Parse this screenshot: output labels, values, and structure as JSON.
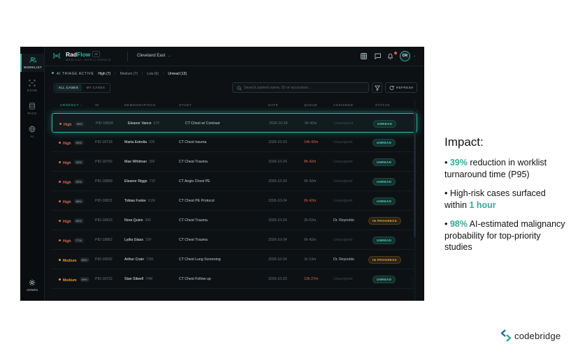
{
  "sidebar": {
    "items": [
      {
        "label": "WORKLIST",
        "icon": "users-icon",
        "active": true
      },
      {
        "label": "EXAM",
        "icon": "scan-icon",
        "active": false
      },
      {
        "label": "PACS",
        "icon": "database-icon",
        "active": false
      },
      {
        "label": "AI",
        "icon": "globe-icon",
        "active": false
      }
    ],
    "admin": {
      "label": "ADMIN",
      "icon": "gear-icon"
    }
  },
  "header": {
    "brand_rad": "Rad",
    "brand_flow": "Flow",
    "brand_badge": "AI",
    "brand_sub": "MEDICAL INTELLIGENCE",
    "site": "Cleveland East",
    "avatar_initials": "DR"
  },
  "triage": {
    "label": "AI TRIAGE ACTIVE",
    "filters": [
      "High (7)",
      "Medium (7)",
      "Low (6)",
      "Unread (13)"
    ]
  },
  "tabs": {
    "all": "ALL CASES",
    "mine": "MY CASES"
  },
  "search": {
    "placeholder": "Search patient name, ID or accession..."
  },
  "refresh_label": "REFRESH",
  "table": {
    "headers": [
      "URGENCY",
      "ID",
      "DEMOGRAPHICS",
      "STUDY",
      "DATE",
      "QUEUE",
      "ASSIGNED",
      "STATUS"
    ],
    "rows": [
      {
        "urgency": "High",
        "level": "high",
        "pct": "98%",
        "id": "PID-18934",
        "name": "Eleanor Vance",
        "age": "67F",
        "study": "CT Chest w/ Contrast",
        "date": "2026-10-24",
        "queue": "0h 42m",
        "queue_warn": false,
        "assigned": "Unassigned",
        "status": "UNREAD",
        "selected": true
      },
      {
        "urgency": "High",
        "level": "high",
        "pct": "96%",
        "id": "PID-18718",
        "name": "Marta Estrella",
        "age": "33F",
        "study": "CT Chest trauma",
        "date": "2026-10-23",
        "queue": "14h 42m",
        "queue_warn": true,
        "assigned": "Unassigned",
        "status": "UNREAD",
        "selected": false
      },
      {
        "urgency": "High",
        "level": "high",
        "pct": "94%",
        "id": "PID-18792",
        "name": "Mae Whitman",
        "age": "39F",
        "study": "CT Chest Trauma",
        "date": "2026-10-24",
        "queue": "8h 42m",
        "queue_warn": true,
        "assigned": "Unassigned",
        "status": "UNREAD",
        "selected": false
      },
      {
        "urgency": "High",
        "level": "high",
        "pct": "92%",
        "id": "PID-18889",
        "name": "Eleanor Riggs",
        "age": "71F",
        "study": "CT Angio Chest PE",
        "date": "2026-10-24",
        "queue": "0h 42m",
        "queue_warn": false,
        "assigned": "Unassigned",
        "status": "UNREAD",
        "selected": false
      },
      {
        "urgency": "High",
        "level": "high",
        "pct": "88%",
        "id": "PID-18821",
        "name": "Tobias Funke",
        "age": "61M",
        "study": "CT Chest PE Protocol",
        "date": "2026-10-24",
        "queue": "6h 42m",
        "queue_warn": true,
        "assigned": "Unassigned",
        "status": "UNREAD",
        "selected": false
      },
      {
        "urgency": "High",
        "level": "high",
        "pct": "82%",
        "id": "PID-18915",
        "name": "Nora Quinn",
        "age": "43F",
        "study": "CT Chest Trauma",
        "date": "2026-10-24",
        "queue": "3h 02m",
        "queue_warn": false,
        "assigned": "Dr. Reynolds",
        "status": "IN PROGRESS",
        "selected": false
      },
      {
        "urgency": "High",
        "level": "high",
        "pct": "77%",
        "id": "PID-18862",
        "name": "Lydia Glass",
        "age": "29F",
        "study": "CT Chest Trauma",
        "date": "2026-10-24",
        "queue": "0h 42m",
        "queue_warn": false,
        "assigned": "Unassigned",
        "status": "UNREAD",
        "selected": false
      },
      {
        "urgency": "Medium",
        "level": "medium",
        "pct": "65%",
        "id": "PID-18932",
        "name": "Arthur Crain",
        "age": "72M",
        "study": "CT Chest Lung Screening",
        "date": "2026-10-24",
        "queue": "1h 13m",
        "queue_warn": false,
        "assigned": "Dr. Reynolds",
        "status": "IN PROGRESS",
        "selected": false
      },
      {
        "urgency": "Medium",
        "level": "medium",
        "pct": "59%",
        "id": "PID-18722",
        "name": "Stan Sitwell",
        "age": "74M",
        "study": "CT Chest Follow-up",
        "date": "2026-10-23",
        "queue": "13h 27m",
        "queue_warn": true,
        "assigned": "Unassigned",
        "status": "UNREAD",
        "selected": false
      }
    ]
  },
  "impact": {
    "title": "Impact:",
    "b1_hl": "39%",
    "b1_rest": " reduction in worklist turnaround time (P95)",
    "b2_pre": "High-risk cases surfaced within ",
    "b2_hl": "1 hour",
    "b3_hl": "98%",
    "b3_rest": " AI-estimated malignancy probability for top-priority studies"
  },
  "footer": {
    "logo_text": "codebridge"
  },
  "colors": {
    "accent": "#2fb8a5",
    "high": "#e0664e",
    "medium": "#e09a3a",
    "app_bg": "#0d1114"
  }
}
